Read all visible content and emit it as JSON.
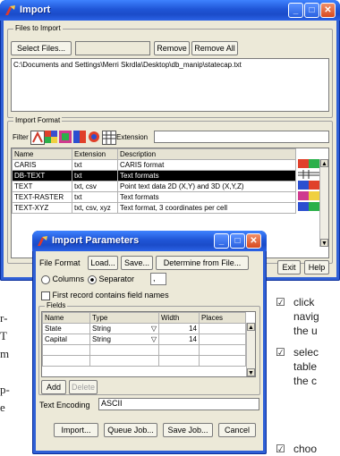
{
  "import_window": {
    "title": "Import",
    "files_group": {
      "legend": "Files to Import",
      "select_files_label": "Select Files...",
      "remove_label": "Remove",
      "remove_all_label": "Remove All",
      "file_path": "C:\\Documents and Settings\\Merri Skrdla\\Desktop\\db_manip\\statecap.txt"
    },
    "format_group": {
      "legend": "Import Format",
      "filter_label": "Filter",
      "extension_label": "Extension",
      "extension_value": "",
      "columns": [
        "Name",
        "Extension",
        "Description"
      ],
      "rows": [
        {
          "name": "CARIS",
          "ext": "txt",
          "desc": "CARIS format",
          "selected": false
        },
        {
          "name": "DB-TEXT",
          "ext": "txt",
          "desc": "Text formats",
          "selected": true
        },
        {
          "name": "TEXT",
          "ext": "txt, csv",
          "desc": "Point text data 2D (X,Y) and 3D (X,Y,Z)",
          "selected": false
        },
        {
          "name": "TEXT-RASTER",
          "ext": "txt",
          "desc": "Text formats",
          "selected": false
        },
        {
          "name": "TEXT-XYZ",
          "ext": "txt, csv, xyz",
          "desc": "Text format, 3 coordinates per cell",
          "selected": false
        }
      ]
    },
    "exit_label": "Exit",
    "help_label": "Help"
  },
  "params_window": {
    "title": "Import Parameters",
    "file_format_label": "File Format",
    "load_label": "Load...",
    "save_label": "Save...",
    "determine_label": "Determine from File...",
    "columns_label": "Columns",
    "separator_label": "Separator",
    "separator_value": ",",
    "first_record_label": "First record contains field names",
    "fields_legend": "Fields",
    "fields_columns": [
      "Name",
      "Type",
      "Width",
      "Places"
    ],
    "fields_rows": [
      {
        "name": "State",
        "type": "String",
        "width": "14",
        "places": ""
      },
      {
        "name": "Capital",
        "type": "String",
        "width": "14",
        "places": ""
      }
    ],
    "add_label": "Add",
    "delete_label": "Delete",
    "text_encoding_label": "Text Encoding",
    "text_encoding_value": "ASCII",
    "import_label": "Import...",
    "queue_label": "Queue Job...",
    "save_job_label": "Save Job...",
    "cancel_label": "Cancel"
  },
  "document": {
    "left_fragments": [
      "r-",
      "T",
      "m",
      "p-",
      "e"
    ],
    "bullets": [
      {
        "lines": [
          "click",
          "navig",
          "the u"
        ]
      },
      {
        "lines": [
          "selec",
          "table",
          "the c"
        ]
      },
      {
        "lines": [
          "choo"
        ]
      }
    ]
  },
  "colors": {
    "title_blue": "#1f55d6",
    "face": "#ece9d8",
    "selected_row": "#000000"
  }
}
